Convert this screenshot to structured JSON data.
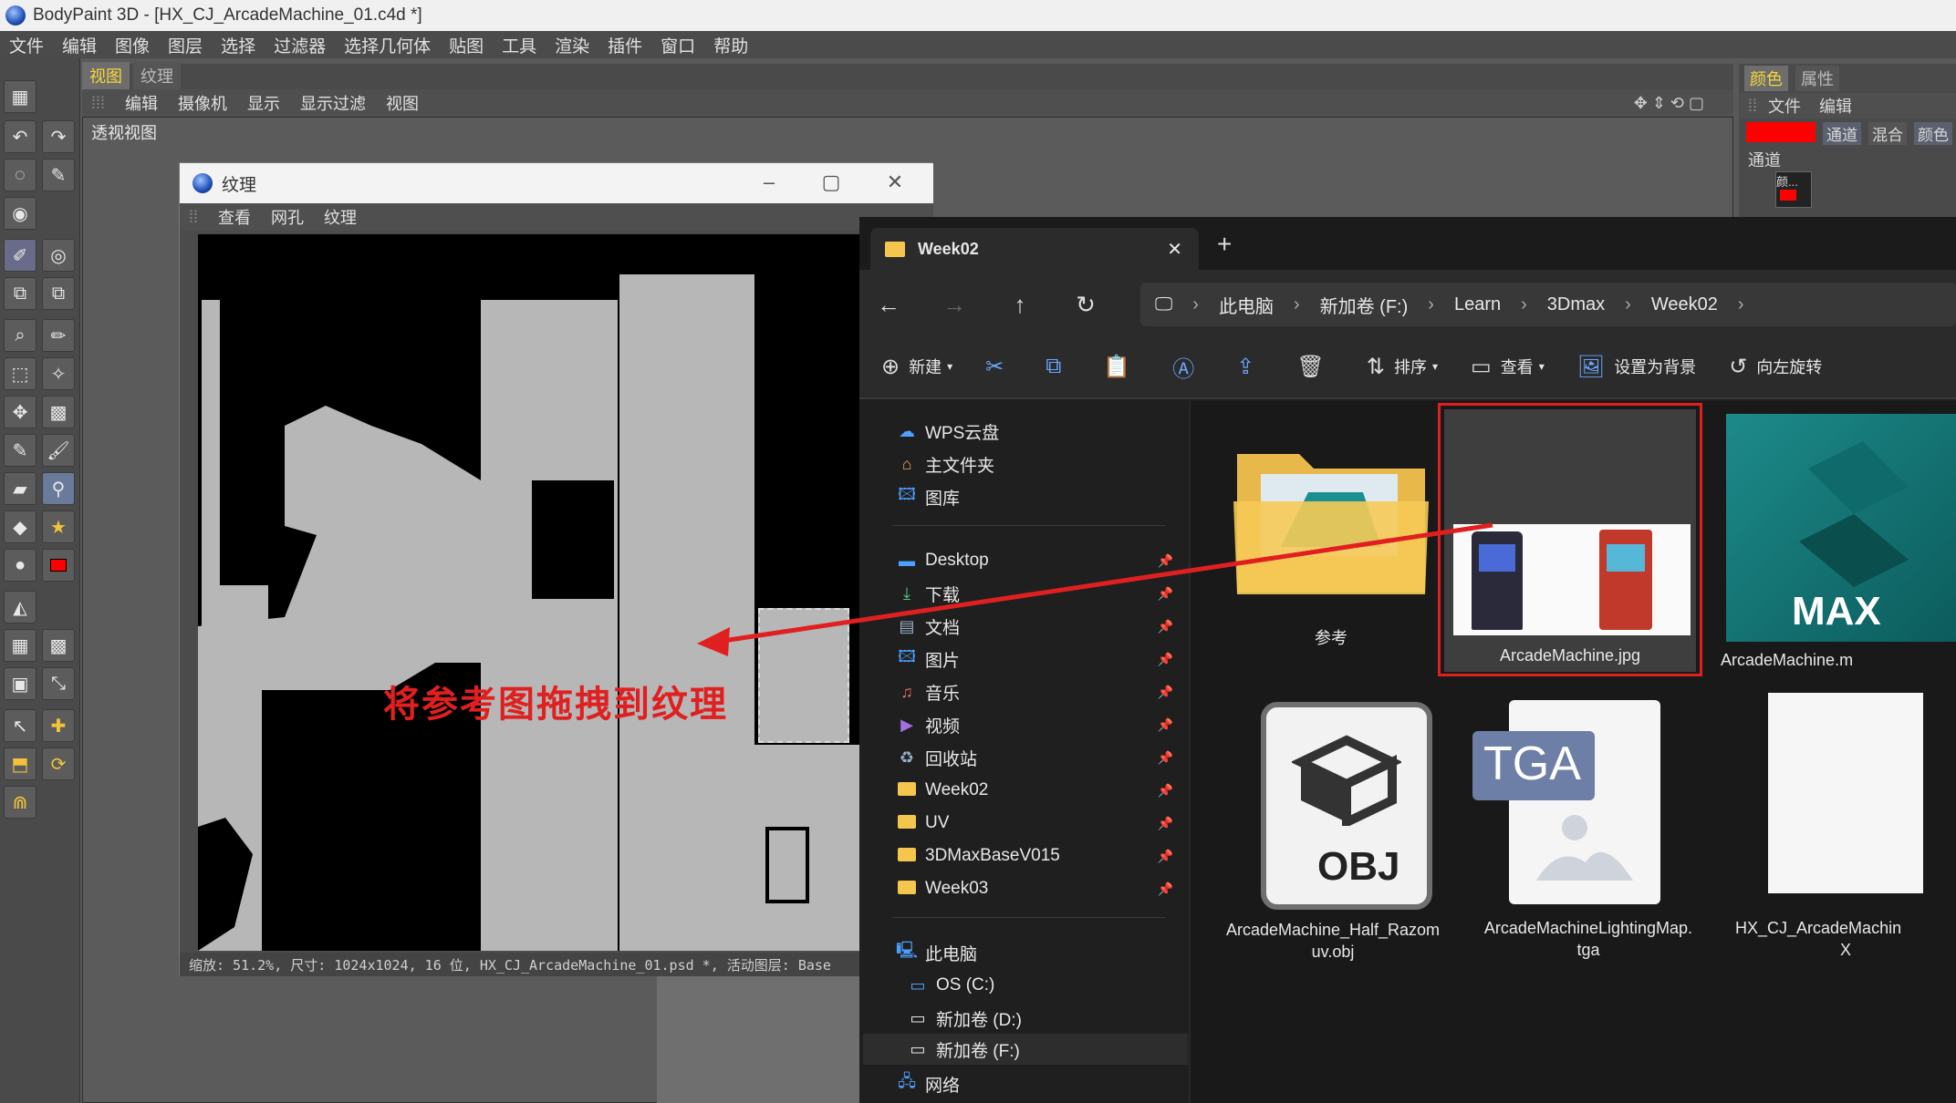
{
  "app": {
    "title": "BodyPaint 3D - [HX_CJ_ArcadeMachine_01.c4d *]",
    "menu": [
      "文件",
      "编辑",
      "图像",
      "图层",
      "选择",
      "过滤器",
      "选择几何体",
      "贴图",
      "工具",
      "渲染",
      "插件",
      "窗口",
      "帮助"
    ]
  },
  "viewport": {
    "tabs": [
      "视图",
      "纹理"
    ],
    "menu": [
      "编辑",
      "摄像机",
      "显示",
      "显示过滤",
      "视图"
    ],
    "label": "透视视图"
  },
  "right_panel": {
    "tabs": [
      "颜色",
      "属性"
    ],
    "menu": [
      "文件",
      "编辑"
    ],
    "subtabs": [
      "通道",
      "混合",
      "颜色"
    ],
    "channel_label": "通道",
    "color_label": "颜...",
    "accent": "#ff0000"
  },
  "texture_window": {
    "title": "纹理",
    "menu": [
      "查看",
      "网孔",
      "纹理"
    ],
    "status": "缩放: 51.2%, 尺寸: 1024x1024, 16 位, HX_CJ_ArcadeMachine_01.psd *, 活动图层: Base"
  },
  "annotation": {
    "text": "将参考图拖拽到纹理",
    "color": "#e02020"
  },
  "explorer": {
    "tab_title": "Week02",
    "new_tab": "+",
    "breadcrumb": [
      "此电脑",
      "新加卷 (F:)",
      "Learn",
      "3Dmax",
      "Week02"
    ],
    "commands": {
      "new": "新建",
      "sort": "排序",
      "view": "查看",
      "set_background": "设置为背景",
      "rotate_left": "向左旋转"
    },
    "sidebar": {
      "top": [
        "WPS云盘",
        "主文件夹",
        "图库"
      ],
      "pinned": [
        "Desktop",
        "下载",
        "文档",
        "图片",
        "音乐",
        "视频",
        "回收站",
        "Week02",
        "UV",
        "3DMaxBaseV015",
        "Week03"
      ],
      "this_pc": "此电脑",
      "drives": [
        "OS (C:)",
        "新加卷 (D:)",
        "新加卷 (F:)"
      ],
      "network": "网络"
    },
    "files": [
      {
        "name": "参考",
        "kind": "folder"
      },
      {
        "name": "ArcadeMachine.jpg",
        "kind": "image",
        "selected": true
      },
      {
        "name": "ArcadeMachine.m",
        "kind": "max",
        "badge": "MAX"
      },
      {
        "name": "ArcadeMachine_Half_Razomuv.obj",
        "line1": "ArcadeMachine_Half_Razom",
        "line2": "uv.obj",
        "kind": "obj",
        "badge": "OBJ"
      },
      {
        "name": "ArcadeMachineLightingMap.tga",
        "line1": "ArcadeMachineLightingMap.",
        "line2": "tga",
        "kind": "tga",
        "badge": "TGA"
      },
      {
        "name": "HX_CJ_ArcadeMachineX",
        "line1": "HX_CJ_ArcadeMachin",
        "line2": "X",
        "kind": "generic"
      }
    ]
  }
}
